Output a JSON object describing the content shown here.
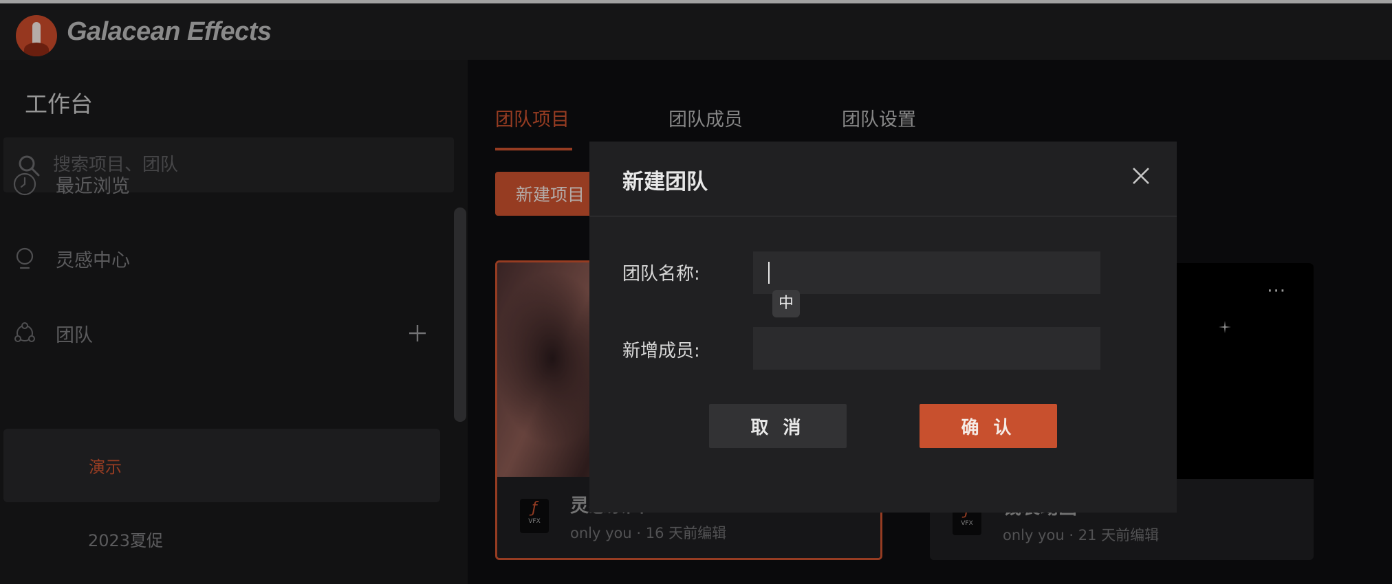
{
  "app": {
    "brand": "Galacean Effects"
  },
  "sidebar": {
    "title": "工作台",
    "search": {
      "placeholder": "搜索项目、团队"
    },
    "nav": [
      {
        "label": "最近浏览",
        "icon": "clock-icon"
      },
      {
        "label": "灵感中心",
        "icon": "lightbulb-icon"
      },
      {
        "label": "团队",
        "icon": "team-icon"
      }
    ],
    "teams": [
      {
        "label": "演示",
        "active": true
      },
      {
        "label": "2023夏促",
        "active": false
      }
    ]
  },
  "main": {
    "tabs": [
      {
        "label": "团队项目",
        "active": true
      },
      {
        "label": "团队成员",
        "active": false
      },
      {
        "label": "团队设置",
        "active": false
      }
    ],
    "new_project_label": "新建项目",
    "cards": [
      {
        "title": "灵感素面",
        "meta": "only you · 16 天前编辑",
        "badge": "VFX"
      },
      {
        "title": "钱袋动画",
        "meta": "only you · 21 天前编辑",
        "badge": "VFX"
      }
    ]
  },
  "modal": {
    "title": "新建团队",
    "team_name_label": "团队名称:",
    "team_name_value": "",
    "add_member_label": "新增成员:",
    "add_member_value": "",
    "ime_indicator": "中",
    "cancel_label": "取 消",
    "confirm_label": "确 认"
  },
  "colors": {
    "accent": "#c8502e",
    "background": "#101012",
    "panel": "#202022"
  }
}
